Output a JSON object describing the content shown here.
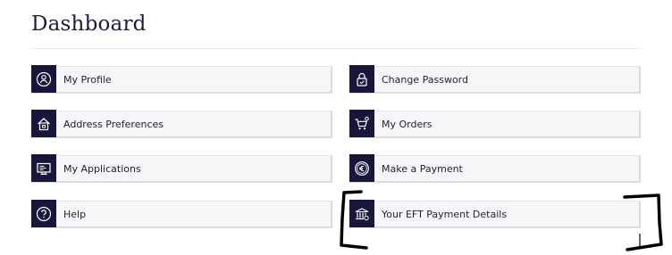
{
  "page": {
    "title": "Dashboard"
  },
  "cards": {
    "profile": "My Profile",
    "change_password": "Change Password",
    "address": "Address Preferences",
    "orders": "My Orders",
    "applications": "My Applications",
    "payment": "Make a Payment",
    "help": "Help",
    "eft": "Your EFT Payment Details"
  },
  "colors": {
    "icon_bg": "#18173b",
    "card_bg": "#f6f6f8",
    "annotation": "#000000"
  },
  "icons": [
    "user-icon",
    "padlock-icon",
    "house-icon",
    "cart-icon",
    "monitor-icon",
    "euro-coin-icon",
    "question-icon",
    "bank-icon"
  ]
}
